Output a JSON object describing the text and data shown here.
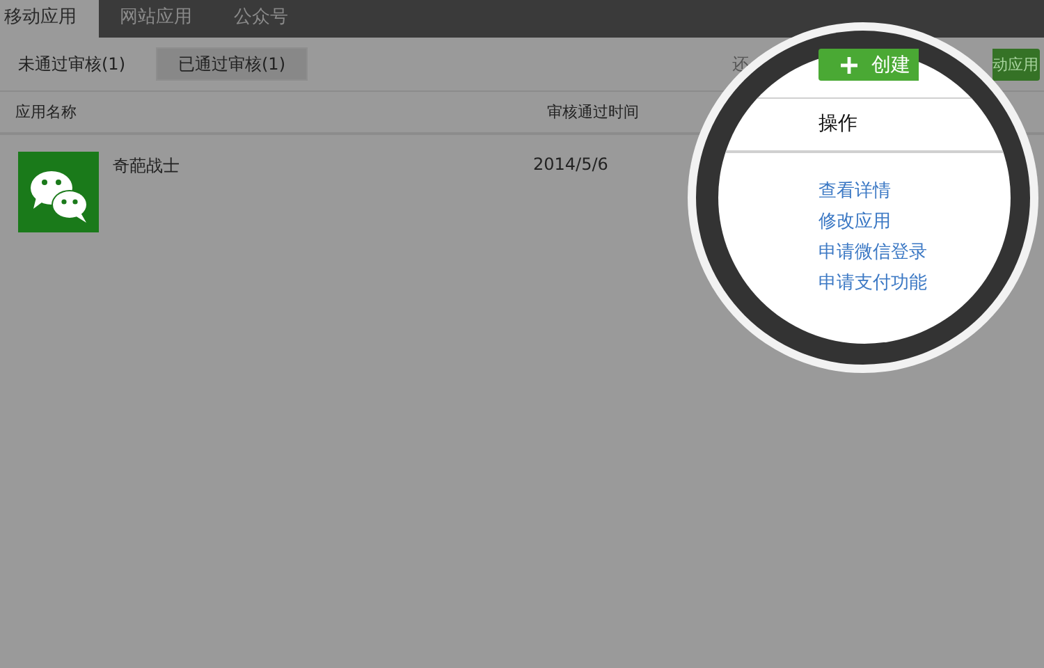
{
  "tabs": [
    {
      "label": "移动应用",
      "selected": true
    },
    {
      "label": "网站应用",
      "selected": false
    },
    {
      "label": "公众号",
      "selected": false
    }
  ],
  "filters": [
    {
      "label": "未通过审核(1)",
      "selected": false
    },
    {
      "label": "已通过审核(1)",
      "selected": true
    }
  ],
  "hint": "还",
  "create_button": {
    "label": "动应用"
  },
  "table": {
    "columns": [
      "应用名称",
      "审核通过时间"
    ],
    "rows": [
      {
        "name": "奇葩战士",
        "date": "2014/5/6"
      }
    ]
  },
  "magnifier": {
    "button_label": "创建",
    "column": "操作",
    "links": [
      "查看详情",
      "修改应用",
      "申请微信登录",
      "申请支付功能"
    ]
  }
}
